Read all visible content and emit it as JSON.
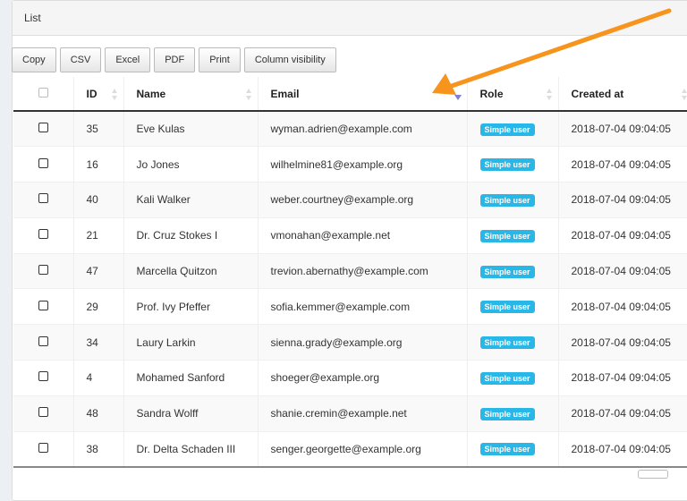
{
  "panel": {
    "title": "List"
  },
  "toolbar": {
    "buttons": [
      "Copy",
      "CSV",
      "Excel",
      "PDF",
      "Print",
      "Column visibility"
    ]
  },
  "table": {
    "columns": [
      "ID",
      "Name",
      "Email",
      "Role",
      "Created at"
    ],
    "sorted_column": "Email",
    "sort_direction": "desc",
    "rows": [
      {
        "id": "35",
        "name": "Eve Kulas",
        "email": "wyman.adrien@example.com",
        "role": "Simple user",
        "created_at": "2018-07-04 09:04:05"
      },
      {
        "id": "16",
        "name": "Jo Jones",
        "email": "wilhelmine81@example.org",
        "role": "Simple user",
        "created_at": "2018-07-04 09:04:05"
      },
      {
        "id": "40",
        "name": "Kali Walker",
        "email": "weber.courtney@example.org",
        "role": "Simple user",
        "created_at": "2018-07-04 09:04:05"
      },
      {
        "id": "21",
        "name": "Dr. Cruz Stokes I",
        "email": "vmonahan@example.net",
        "role": "Simple user",
        "created_at": "2018-07-04 09:04:05"
      },
      {
        "id": "47",
        "name": "Marcella Quitzon",
        "email": "trevion.abernathy@example.com",
        "role": "Simple user",
        "created_at": "2018-07-04 09:04:05"
      },
      {
        "id": "29",
        "name": "Prof. Ivy Pfeffer",
        "email": "sofia.kemmer@example.com",
        "role": "Simple user",
        "created_at": "2018-07-04 09:04:05"
      },
      {
        "id": "34",
        "name": "Laury Larkin",
        "email": "sienna.grady@example.org",
        "role": "Simple user",
        "created_at": "2018-07-04 09:04:05"
      },
      {
        "id": "4",
        "name": "Mohamed Sanford",
        "email": "shoeger@example.org",
        "role": "Simple user",
        "created_at": "2018-07-04 09:04:05"
      },
      {
        "id": "48",
        "name": "Sandra Wolff",
        "email": "shanie.cremin@example.net",
        "role": "Simple user",
        "created_at": "2018-07-04 09:04:05"
      },
      {
        "id": "38",
        "name": "Dr. Delta Schaden III",
        "email": "senger.georgette@example.org",
        "role": "Simple user",
        "created_at": "2018-07-04 09:04:05"
      }
    ]
  },
  "colors": {
    "badge": "#29b7e8",
    "annotation_arrow": "#f7941d",
    "sort_indicator": "#7f7fd5"
  }
}
